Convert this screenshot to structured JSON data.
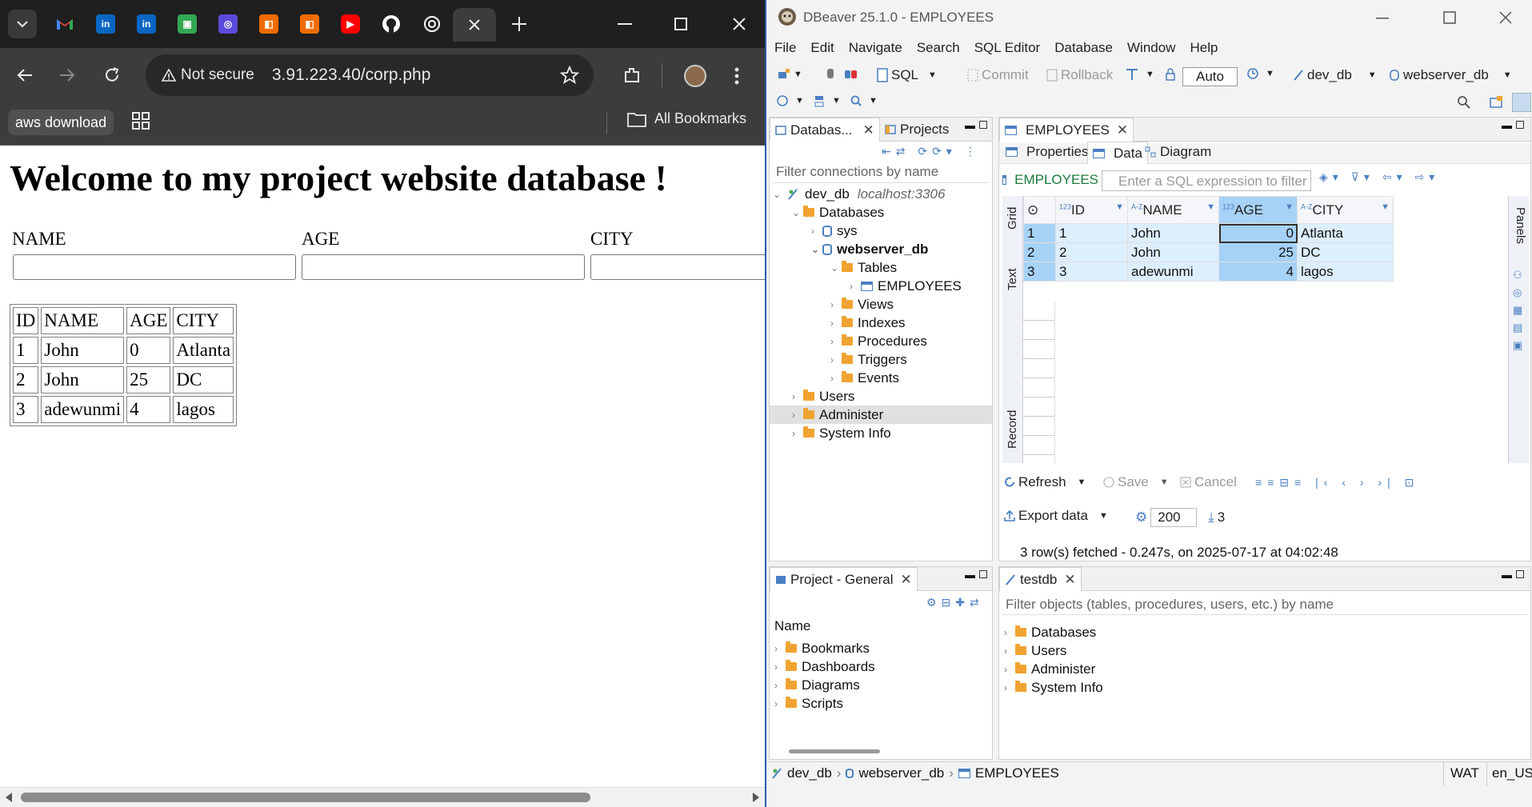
{
  "chrome": {
    "tabs": [
      {
        "icon": "gmail-icon",
        "color": "#ea4335"
      },
      {
        "icon": "linkedin-icon",
        "color": "#0a66c2"
      },
      {
        "icon": "linkedin-icon",
        "color": "#0a66c2"
      },
      {
        "icon": "green-app-icon",
        "color": "#34a853"
      },
      {
        "icon": "purple-app-icon",
        "color": "#5b4bdb"
      },
      {
        "icon": "orange-app-icon",
        "color": "#ef6c00"
      },
      {
        "icon": "orange-app-icon",
        "color": "#ef6c00"
      },
      {
        "icon": "youtube-icon",
        "color": "#ff0000"
      },
      {
        "icon": "github-icon",
        "color": "#ffffff"
      },
      {
        "icon": "openai-icon",
        "color": "#ffffff"
      }
    ],
    "security_label": "Not secure",
    "url": "3.91.223.40/corp.php",
    "bookmark_chip": "aws download",
    "all_bookmarks": "All Bookmarks"
  },
  "page": {
    "heading": "Welcome to my project website database !",
    "form_labels": [
      "NAME",
      "AGE",
      "CITY"
    ],
    "table_headers": [
      "ID",
      "NAME",
      "AGE",
      "CITY"
    ],
    "rows": [
      [
        "1",
        "John",
        "0",
        "Atlanta"
      ],
      [
        "2",
        "John",
        "25",
        "DC"
      ],
      [
        "3",
        "adewunmi",
        "4",
        "lagos"
      ]
    ]
  },
  "dbeaver": {
    "title": "DBeaver 25.1.0 - EMPLOYEES",
    "menu": [
      "File",
      "Edit",
      "Navigate",
      "Search",
      "SQL Editor",
      "Database",
      "Window",
      "Help"
    ],
    "toolbar": {
      "sql": "SQL",
      "commit": "Commit",
      "rollback": "Rollback",
      "auto": "Auto",
      "connection": "dev_db",
      "schema": "webserver_db"
    },
    "navigator": {
      "tab_db": "Databas...",
      "tab_projects": "Projects",
      "filter_placeholder": "Filter connections by name",
      "connection": "dev_db",
      "host": "localhost:3306",
      "items": {
        "databases": "Databases",
        "sys": "sys",
        "webserver_db": "webserver_db",
        "tables": "Tables",
        "employees": "EMPLOYEES",
        "views": "Views",
        "indexes": "Indexes",
        "procedures": "Procedures",
        "triggers": "Triggers",
        "events": "Events",
        "users": "Users",
        "administer": "Administer",
        "system_info": "System Info"
      }
    },
    "editor": {
      "tab": "EMPLOYEES",
      "subtabs": [
        "Properties",
        "Data",
        "Diagram"
      ],
      "table_name": "EMPLOYEES",
      "filter_placeholder": "Enter a SQL expression to filter re",
      "columns": [
        {
          "type": "123",
          "name": "ID"
        },
        {
          "type": "A-Z",
          "name": "NAME"
        },
        {
          "type": "123",
          "name": "AGE"
        },
        {
          "type": "A-Z",
          "name": "CITY"
        }
      ],
      "rows": [
        [
          "1",
          "1",
          "John",
          "0",
          "Atlanta"
        ],
        [
          "2",
          "2",
          "John",
          "25",
          "DC"
        ],
        [
          "3",
          "3",
          "adewunmi",
          "4",
          "lagos"
        ]
      ],
      "side_tabs": [
        "Grid",
        "Text",
        "Record"
      ],
      "right_tab": "Panels",
      "refresh": "Refresh",
      "save": "Save",
      "cancel": "Cancel",
      "export": "Export data",
      "fetch_size": "200",
      "row_count": "3",
      "status": "3 row(s) fetched - 0.247s, on 2025-07-17 at 04:02:48"
    },
    "project": {
      "tab": "Project - General",
      "column": "Name",
      "items": [
        "Bookmarks",
        "Dashboards",
        "Diagrams",
        "Scripts"
      ]
    },
    "testdb": {
      "tab": "testdb",
      "filter_placeholder": "Filter objects (tables, procedures, users, etc.) by name",
      "items": [
        "Databases",
        "Users",
        "Administer",
        "System Info"
      ]
    },
    "statusbar": {
      "crumbs": [
        "dev_db",
        "webserver_db",
        "EMPLOYEES"
      ],
      "tz": "WAT",
      "locale": "en_US"
    }
  }
}
